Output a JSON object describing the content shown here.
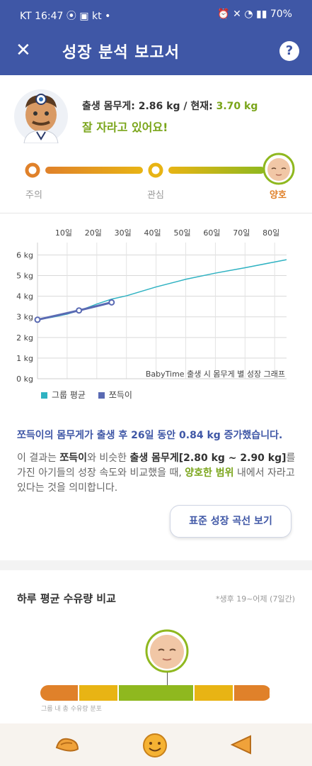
{
  "status_bar": {
    "left": "KT 16:47 ⦿ ▣ kt •",
    "right": "⏰ ✕ ◔ ▮▮ 70%"
  },
  "app_bar": {
    "title": "성장 분석 보고서",
    "close_glyph": "✕",
    "help_glyph": "?"
  },
  "summary_top": {
    "birth_prefix": "출생 몸무게: 2.86 kg / 현재: ",
    "current_weight": "3.70 kg",
    "message": "잘 자라고 있어요!"
  },
  "progress_steps": [
    {
      "label": "주의"
    },
    {
      "label": "관심"
    },
    {
      "label": "양호"
    }
  ],
  "chart_data": {
    "type": "line",
    "x_tick_labels": [
      "10일",
      "20일",
      "30일",
      "40일",
      "50일",
      "60일",
      "70일",
      "80일"
    ],
    "y_tick_labels": [
      "0 kg",
      "1 kg",
      "2 kg",
      "3 kg",
      "4 kg",
      "5 kg",
      "6 kg"
    ],
    "xlim": [
      0,
      84
    ],
    "ylim": [
      0,
      6.6
    ],
    "annotation": "BabyTime 출생 시 몸무게 별 성장 그래프",
    "series": [
      {
        "name": "그룹 평균",
        "color": "#2fb2c2",
        "x": [
          0,
          5,
          10,
          15,
          20,
          25,
          30,
          40,
          50,
          60,
          70,
          80,
          84
        ],
        "y": [
          2.86,
          2.98,
          3.13,
          3.35,
          3.62,
          3.86,
          4.02,
          4.45,
          4.82,
          5.12,
          5.38,
          5.66,
          5.77
        ]
      },
      {
        "name": "쪼득이",
        "color": "#5a6ab3",
        "x": [
          0,
          14,
          25
        ],
        "y": [
          2.86,
          3.31,
          3.7
        ],
        "markers": true
      }
    ]
  },
  "result": {
    "summary": "쪼득이의 몸무게가 출생 후 26일 동안 0.84 kg 증가했습니다.",
    "p1": "이 결과는 ",
    "name": "쪼득이",
    "p2": "와 비슷한 ",
    "range_label": "출생 몸무게[2.80 kg ~ 2.90 kg]",
    "p3": "를 가진 아기들의 성장 속도와 비교했을 때, ",
    "good_range": "양호한 범위",
    "p4": " 내에서 자라고 있다는 것을 의미합니다."
  },
  "curve_button": {
    "label": "표준 성장 곡선 보기"
  },
  "intake": {
    "title": "하루 평균 수유량 비교",
    "period": "*생후 19~어제 (7일간)",
    "segments": [
      {
        "color": "#e0812a",
        "share": 0.17
      },
      {
        "color": "#e8b414",
        "share": 0.17
      },
      {
        "color": "#8fb81f",
        "share": 0.33
      },
      {
        "color": "#e8b414",
        "share": 0.17
      },
      {
        "color": "#e0812a",
        "share": 0.16
      }
    ],
    "marker_position": 0.55,
    "caption": "그룹 내 총 수유량 분포"
  },
  "colors": {
    "primary": "#3f57a6",
    "green": "#7aa51a",
    "orange": "#e0812a",
    "teal": "#2fb2c2"
  }
}
